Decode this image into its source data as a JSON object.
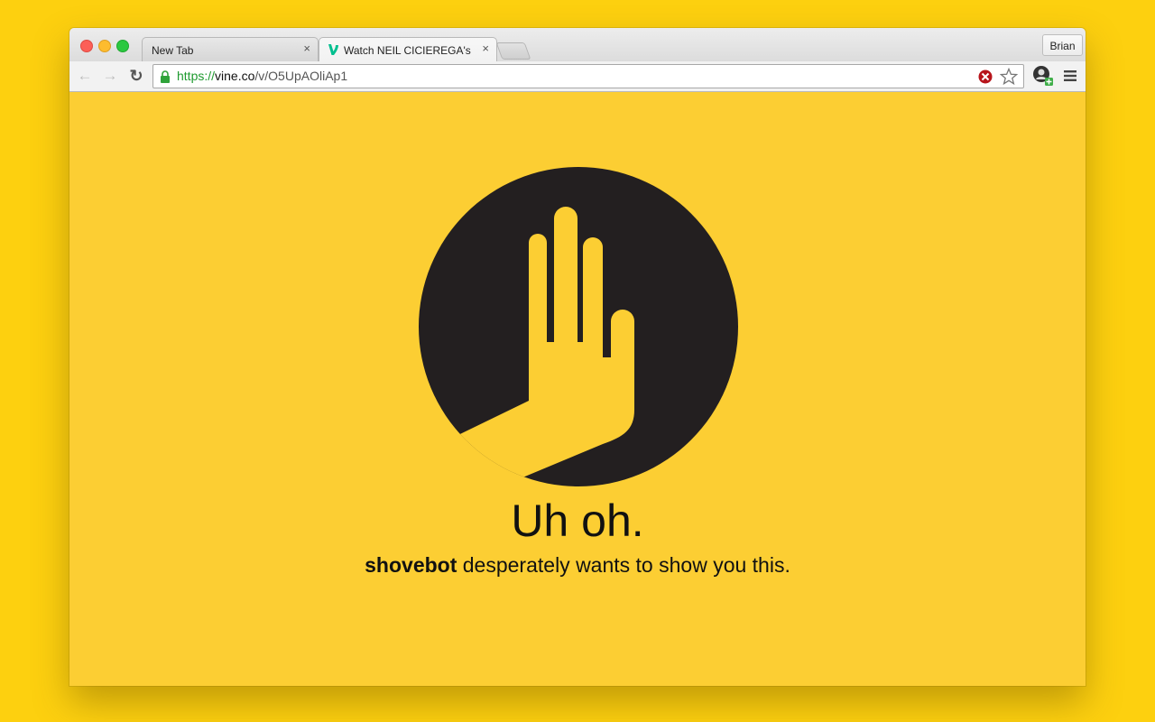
{
  "browser": {
    "tabs": [
      {
        "title": "New Tab",
        "active": false
      },
      {
        "title": "Watch NEIL CICIEREGA's Vi",
        "active": true
      }
    ],
    "profile_name": "Brian",
    "url": {
      "scheme": "https://",
      "host": "vine.co",
      "path": "/v/O5UpAOliAp1"
    }
  },
  "page": {
    "headline": "Uh oh.",
    "username": "shovebot",
    "message": " desperately wants to show you this."
  },
  "colors": {
    "page_background": "#FCCE33",
    "outer_background": "#FDD00F",
    "logo_circle": "#231F20",
    "secure_green": "#1E9A2F"
  },
  "icons": {
    "close": "×",
    "back": "←",
    "forward": "→",
    "reload": "↻"
  }
}
